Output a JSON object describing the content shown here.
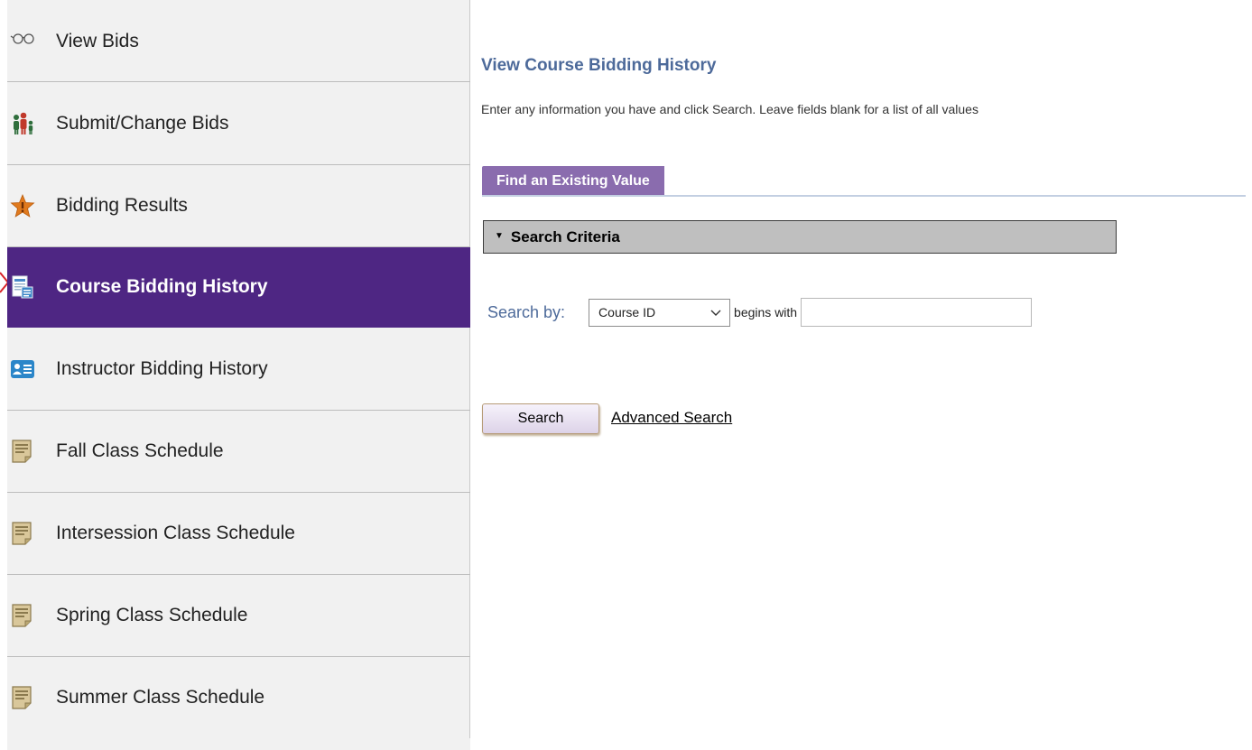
{
  "sidebar": {
    "items": [
      {
        "label": "View Bids",
        "icon": "glasses-icon"
      },
      {
        "label": "Submit/Change Bids",
        "icon": "people-icon"
      },
      {
        "label": "Bidding Results",
        "icon": "star-icon"
      },
      {
        "label": "Course Bidding History",
        "icon": "document-icon",
        "active": true
      },
      {
        "label": "Instructor Bidding History",
        "icon": "contact-card-icon"
      },
      {
        "label": "Fall Class Schedule",
        "icon": "schedule-icon"
      },
      {
        "label": "Intersession Class Schedule",
        "icon": "schedule-icon"
      },
      {
        "label": "Spring Class Schedule",
        "icon": "schedule-icon"
      },
      {
        "label": "Summer Class Schedule",
        "icon": "schedule-icon"
      }
    ]
  },
  "main": {
    "title": "View Course Bidding History",
    "instructions": "Enter any information you have and click Search. Leave fields blank for a list of all values",
    "tab_label": "Find an Existing Value",
    "criteria_label": "Search Criteria",
    "search_by_label": "Search by:",
    "search_field": {
      "selected": "Course ID"
    },
    "operator_label": "begins with",
    "search_input": {
      "value": "",
      "placeholder": ""
    },
    "search_button": "Search",
    "advanced_search_link": "Advanced Search"
  },
  "colors": {
    "active_nav_bg": "#4e2683",
    "tab_bg": "#8a6cae",
    "title_text": "#4d6a9a",
    "criteria_bg": "#bfbfbf"
  }
}
